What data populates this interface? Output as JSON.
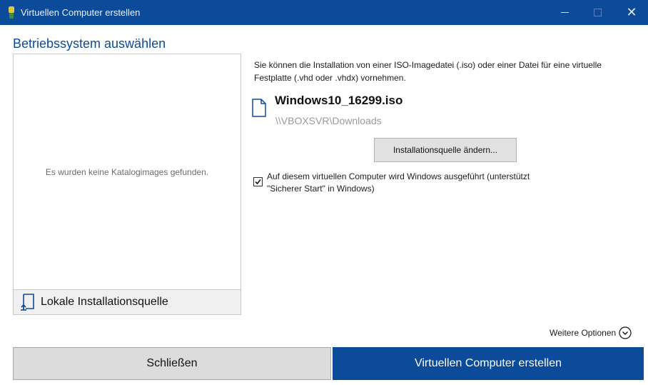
{
  "window": {
    "title": "Virtuellen Computer erstellen",
    "minimize": "minimize",
    "maximize": "maximize",
    "close": "close"
  },
  "section_title": "Betriebssystem auswählen",
  "catalog": {
    "empty_text": "Es wurden keine Katalogimages gefunden."
  },
  "local_source": {
    "label": "Lokale Installationsquelle",
    "icon": "install-source-icon"
  },
  "source": {
    "description": "Sie können die Installation von einer ISO-Imagedatei (.iso) oder einer Datei für eine virtuelle Festplatte (.vhd oder .vhdx) vornehmen.",
    "file_name": "Windows10_16299.iso",
    "file_path": "\\\\VBOXSVR\\Downloads",
    "change_button": "Installationsquelle ändern...",
    "file_icon": "file-icon"
  },
  "windows_checkbox": {
    "checked": true,
    "label": "Auf diesem virtuellen Computer wird Windows ausgeführt (unterstützt \"Sicherer Start\" in Windows)"
  },
  "more_options": {
    "label": "Weitere Optionen",
    "icon": "chevron-down-circle-icon"
  },
  "buttons": {
    "close": "Schließen",
    "create": "Virtuellen Computer erstellen"
  },
  "colors": {
    "accent": "#0c4a9a",
    "button_gray": "#dcdcdc"
  }
}
